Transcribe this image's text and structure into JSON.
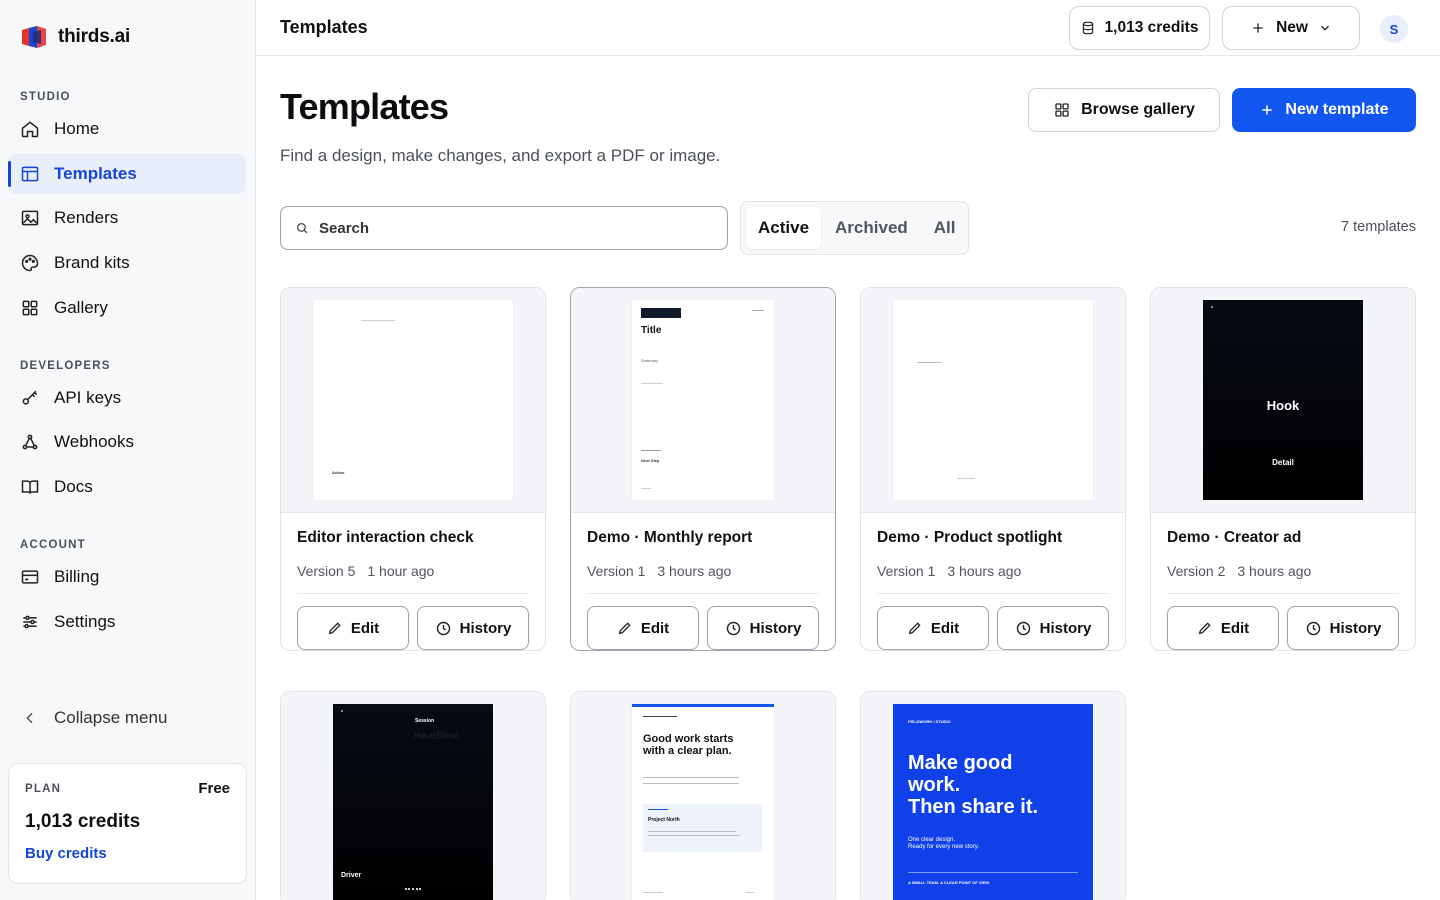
{
  "brand": {
    "name": "thirds.ai"
  },
  "sidebar": {
    "sections": [
      {
        "label": "STUDIO"
      },
      {
        "label": "DEVELOPERS"
      },
      {
        "label": "ACCOUNT"
      }
    ],
    "items": [
      {
        "label": "Home",
        "icon": "home-icon"
      },
      {
        "label": "Templates",
        "icon": "layout-icon",
        "active": true
      },
      {
        "label": "Renders",
        "icon": "image-icon"
      },
      {
        "label": "Brand kits",
        "icon": "palette-icon"
      },
      {
        "label": "Gallery",
        "icon": "grid-icon"
      },
      {
        "label": "API keys",
        "icon": "key-icon"
      },
      {
        "label": "Webhooks",
        "icon": "webhook-icon"
      },
      {
        "label": "Docs",
        "icon": "book-icon"
      },
      {
        "label": "Billing",
        "icon": "credit-card-icon"
      },
      {
        "label": "Settings",
        "icon": "sliders-icon"
      }
    ],
    "collapse_label": "Collapse menu",
    "plan": {
      "label": "PLAN",
      "tier": "Free",
      "credits": "1,013 credits",
      "buy_label": "Buy credits"
    }
  },
  "header": {
    "title": "Templates",
    "credits_label": "1,013 credits",
    "new_label": "New",
    "avatar_initial": "S"
  },
  "main": {
    "title": "Templates",
    "subtitle": "Find a design, make changes, and export a PDF or image.",
    "browse_gallery_label": "Browse gallery",
    "new_template_label": "New template",
    "search_placeholder": "Search",
    "filters": [
      "Active",
      "Archived",
      "All"
    ],
    "active_filter": "Active",
    "count_label": "7 templates",
    "edit_label": "Edit",
    "history_label": "History",
    "cards": [
      {
        "title": "Editor interaction check",
        "version": "Version 5",
        "time": "1 hour ago",
        "thumb_text": [
          "Action"
        ]
      },
      {
        "title": "Demo · Monthly report",
        "version": "Version 1",
        "time": "3 hours ago",
        "thumb_text": [
          "Title",
          "Summary",
          "Next Step"
        ]
      },
      {
        "title": "Demo · Product spotlight",
        "version": "Version 1",
        "time": "3 hours ago",
        "thumb_text": []
      },
      {
        "title": "Demo · Creator ad",
        "version": "Version 2",
        "time": "3 hours ago",
        "thumb_text": [
          "Hook",
          "Detail"
        ]
      }
    ],
    "partial_cards": [
      {
        "thumb_text": [
          "Session",
          "Headline",
          "Driver"
        ]
      },
      {
        "thumb_text": [
          "Good work starts",
          "with a clear plan.",
          "Project North"
        ]
      },
      {
        "thumb_text": [
          "FIELDWORK / STUDIO",
          "Make good",
          "work.",
          "Then share it.",
          "One clear design.",
          "Ready for every new story.",
          "A SMALL TEAM. A CLEAR POINT OF VIEW."
        ]
      }
    ]
  },
  "colors": {
    "accent": "#1256f0",
    "active_nav": "#1546d8"
  }
}
